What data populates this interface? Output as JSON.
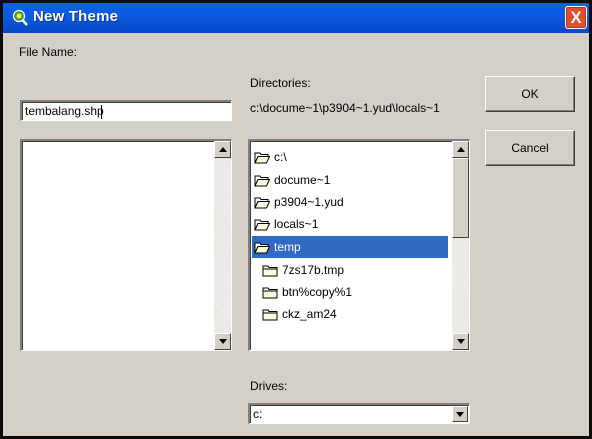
{
  "window": {
    "title": "New Theme",
    "close_glyph": "X"
  },
  "file_name": {
    "label": "File Name:",
    "value": "tembalang.shp",
    "files": []
  },
  "directories": {
    "label": "Directories:",
    "current_path": "c:\\docume~1\\p3904~1.yud\\locals~1",
    "items": [
      {
        "name": "c:\\",
        "icon": "open-folder-icon",
        "selected": false
      },
      {
        "name": "docume~1",
        "icon": "open-folder-icon",
        "selected": false
      },
      {
        "name": "p3904~1.yud",
        "icon": "open-folder-icon",
        "selected": false
      },
      {
        "name": "locals~1",
        "icon": "open-folder-icon",
        "selected": false
      },
      {
        "name": "temp",
        "icon": "open-folder-icon",
        "selected": true
      },
      {
        "name": "7zs17b.tmp",
        "icon": "closed-folder-icon",
        "selected": false
      },
      {
        "name": "btn%copy%1",
        "icon": "closed-folder-icon",
        "selected": false
      },
      {
        "name": "ckz_am24",
        "icon": "closed-folder-icon",
        "selected": false
      }
    ]
  },
  "drives": {
    "label": "Drives:",
    "selected": "c:"
  },
  "buttons": {
    "ok": "OK",
    "cancel": "Cancel"
  },
  "colors": {
    "titlebar": "#0a5fe8",
    "selection": "#316ac5",
    "dialog_bg": "#d4d0c8",
    "close_button": "#e0502e"
  }
}
